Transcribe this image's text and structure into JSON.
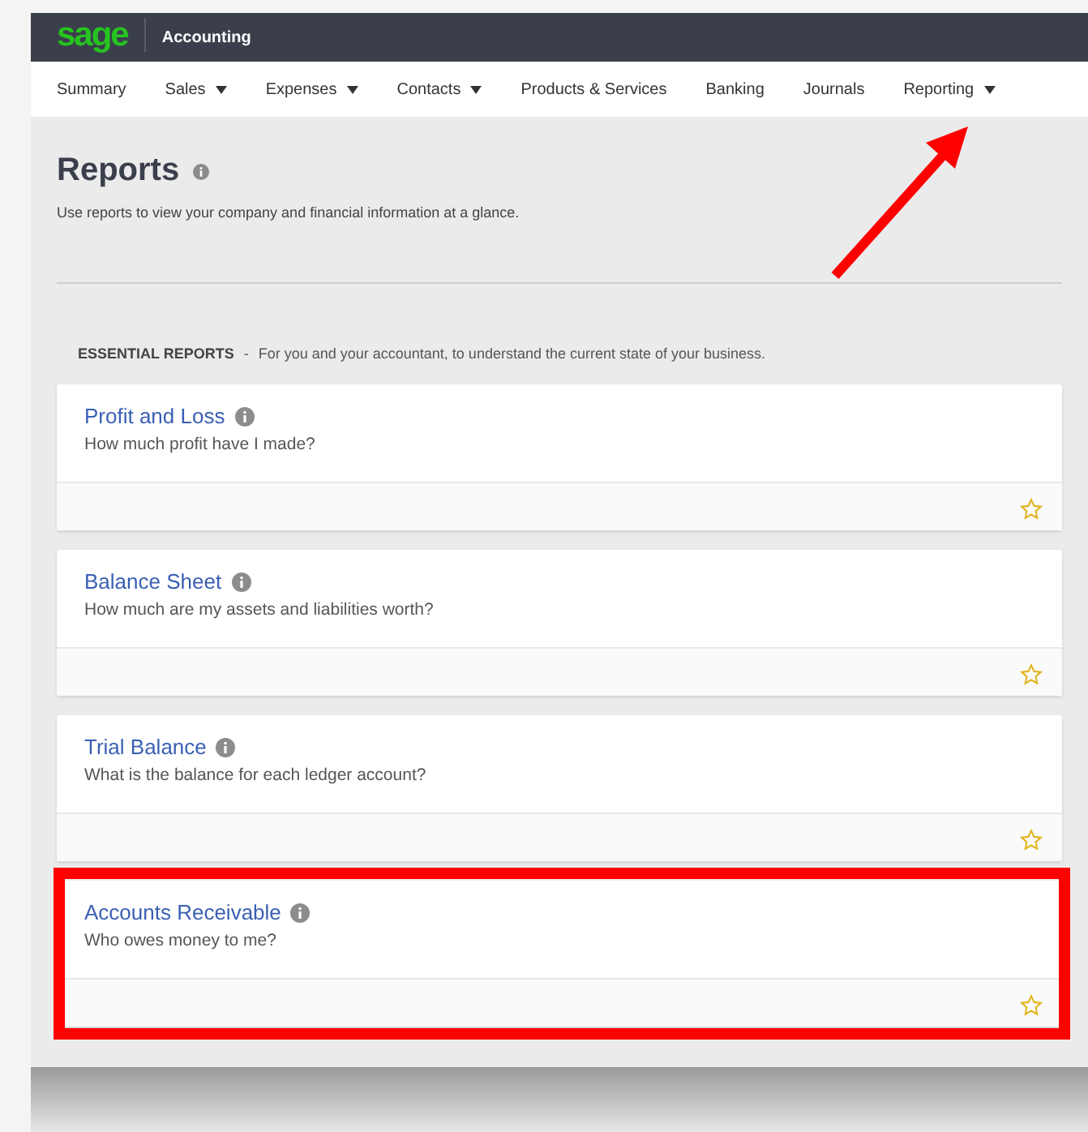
{
  "header": {
    "logo": "sage",
    "product": "Accounting"
  },
  "nav": [
    {
      "label": "Summary",
      "dropdown": false
    },
    {
      "label": "Sales",
      "dropdown": true
    },
    {
      "label": "Expenses",
      "dropdown": true
    },
    {
      "label": "Contacts",
      "dropdown": true
    },
    {
      "label": "Products & Services",
      "dropdown": false
    },
    {
      "label": "Banking",
      "dropdown": false
    },
    {
      "label": "Journals",
      "dropdown": false
    },
    {
      "label": "Reporting",
      "dropdown": true,
      "pointed_at": true
    }
  ],
  "page": {
    "title": "Reports",
    "subtitle": "Use reports to view your company and financial information at a glance."
  },
  "section": {
    "heading": "ESSENTIAL REPORTS",
    "separator": "-",
    "description": "For you and your accountant, to understand the current state of your business."
  },
  "reports": [
    {
      "title": "Profit and Loss",
      "question": "How much profit have I made?",
      "highlighted": false
    },
    {
      "title": "Balance Sheet",
      "question": "How much are my assets and liabilities worth?",
      "highlighted": false
    },
    {
      "title": "Trial Balance",
      "question": "What is the balance for each ledger account?",
      "highlighted": false
    },
    {
      "title": "Accounts Receivable",
      "question": "Who owes money to me?",
      "highlighted": true
    }
  ]
}
